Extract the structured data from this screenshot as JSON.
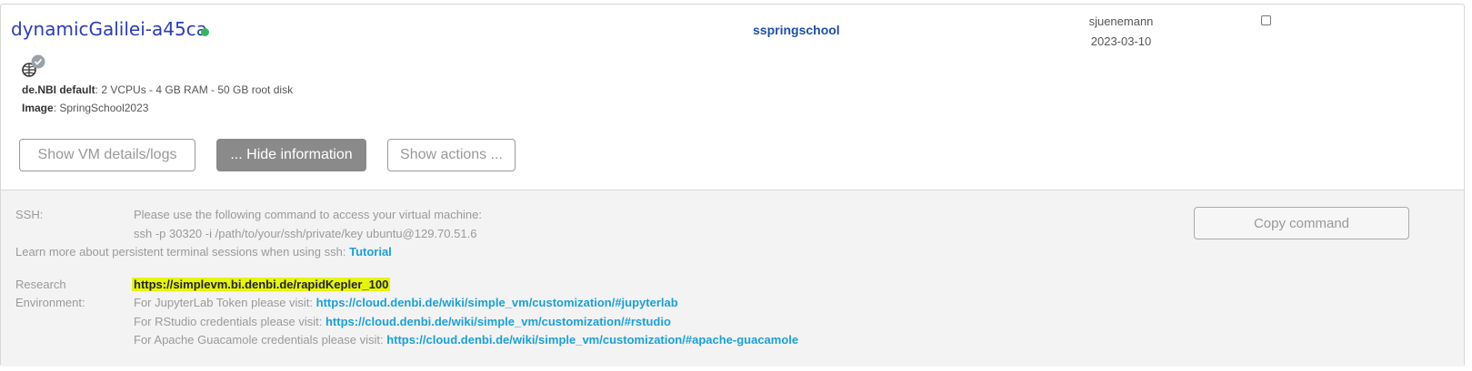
{
  "vm": {
    "name": "dynamicGalilei-a45ca",
    "status_color": "#2eb85c",
    "project": "sspringschool",
    "owner": "sjuenemann",
    "date": "2023-03-10",
    "flavor_label": "de.NBI default",
    "flavor_value": ": 2 VCPUs - 4 GB RAM - 50 GB root disk",
    "image_label": "Image",
    "image_value": ": SpringSchool2023"
  },
  "buttons": {
    "details": "Show VM details/logs",
    "hide_info": "... Hide information",
    "actions": "Show actions ...",
    "copy": "Copy command"
  },
  "ssh": {
    "label": "SSH:",
    "line1": "Please use the following command to access your virtual machine:",
    "command": "ssh -p 30320 -i /path/to/your/ssh/private/key ubuntu@129.70.51.6",
    "learn_more": "Learn more about persistent terminal sessions when using ssh: ",
    "tutorial": "Tutorial"
  },
  "research": {
    "label1": "Research",
    "label2": "Environment:",
    "url": "https://simplevm.bi.denbi.de/rapidKepler_100",
    "jupyter_text": "For JupyterLab Token please visit: ",
    "jupyter_link": "https://cloud.denbi.de/wiki/simple_vm/customization/#jupyterlab",
    "rstudio_text": "For RStudio credentials please visit: ",
    "rstudio_link": "https://cloud.denbi.de/wiki/simple_vm/customization/#rstudio",
    "guac_text": "For Apache Guacamole credentials please visit: ",
    "guac_link": "https://cloud.denbi.de/wiki/simple_vm/customization/#apache-guacamole"
  },
  "icons": {
    "network": "globe-check-icon",
    "checkbox": "checkbox-icon"
  }
}
